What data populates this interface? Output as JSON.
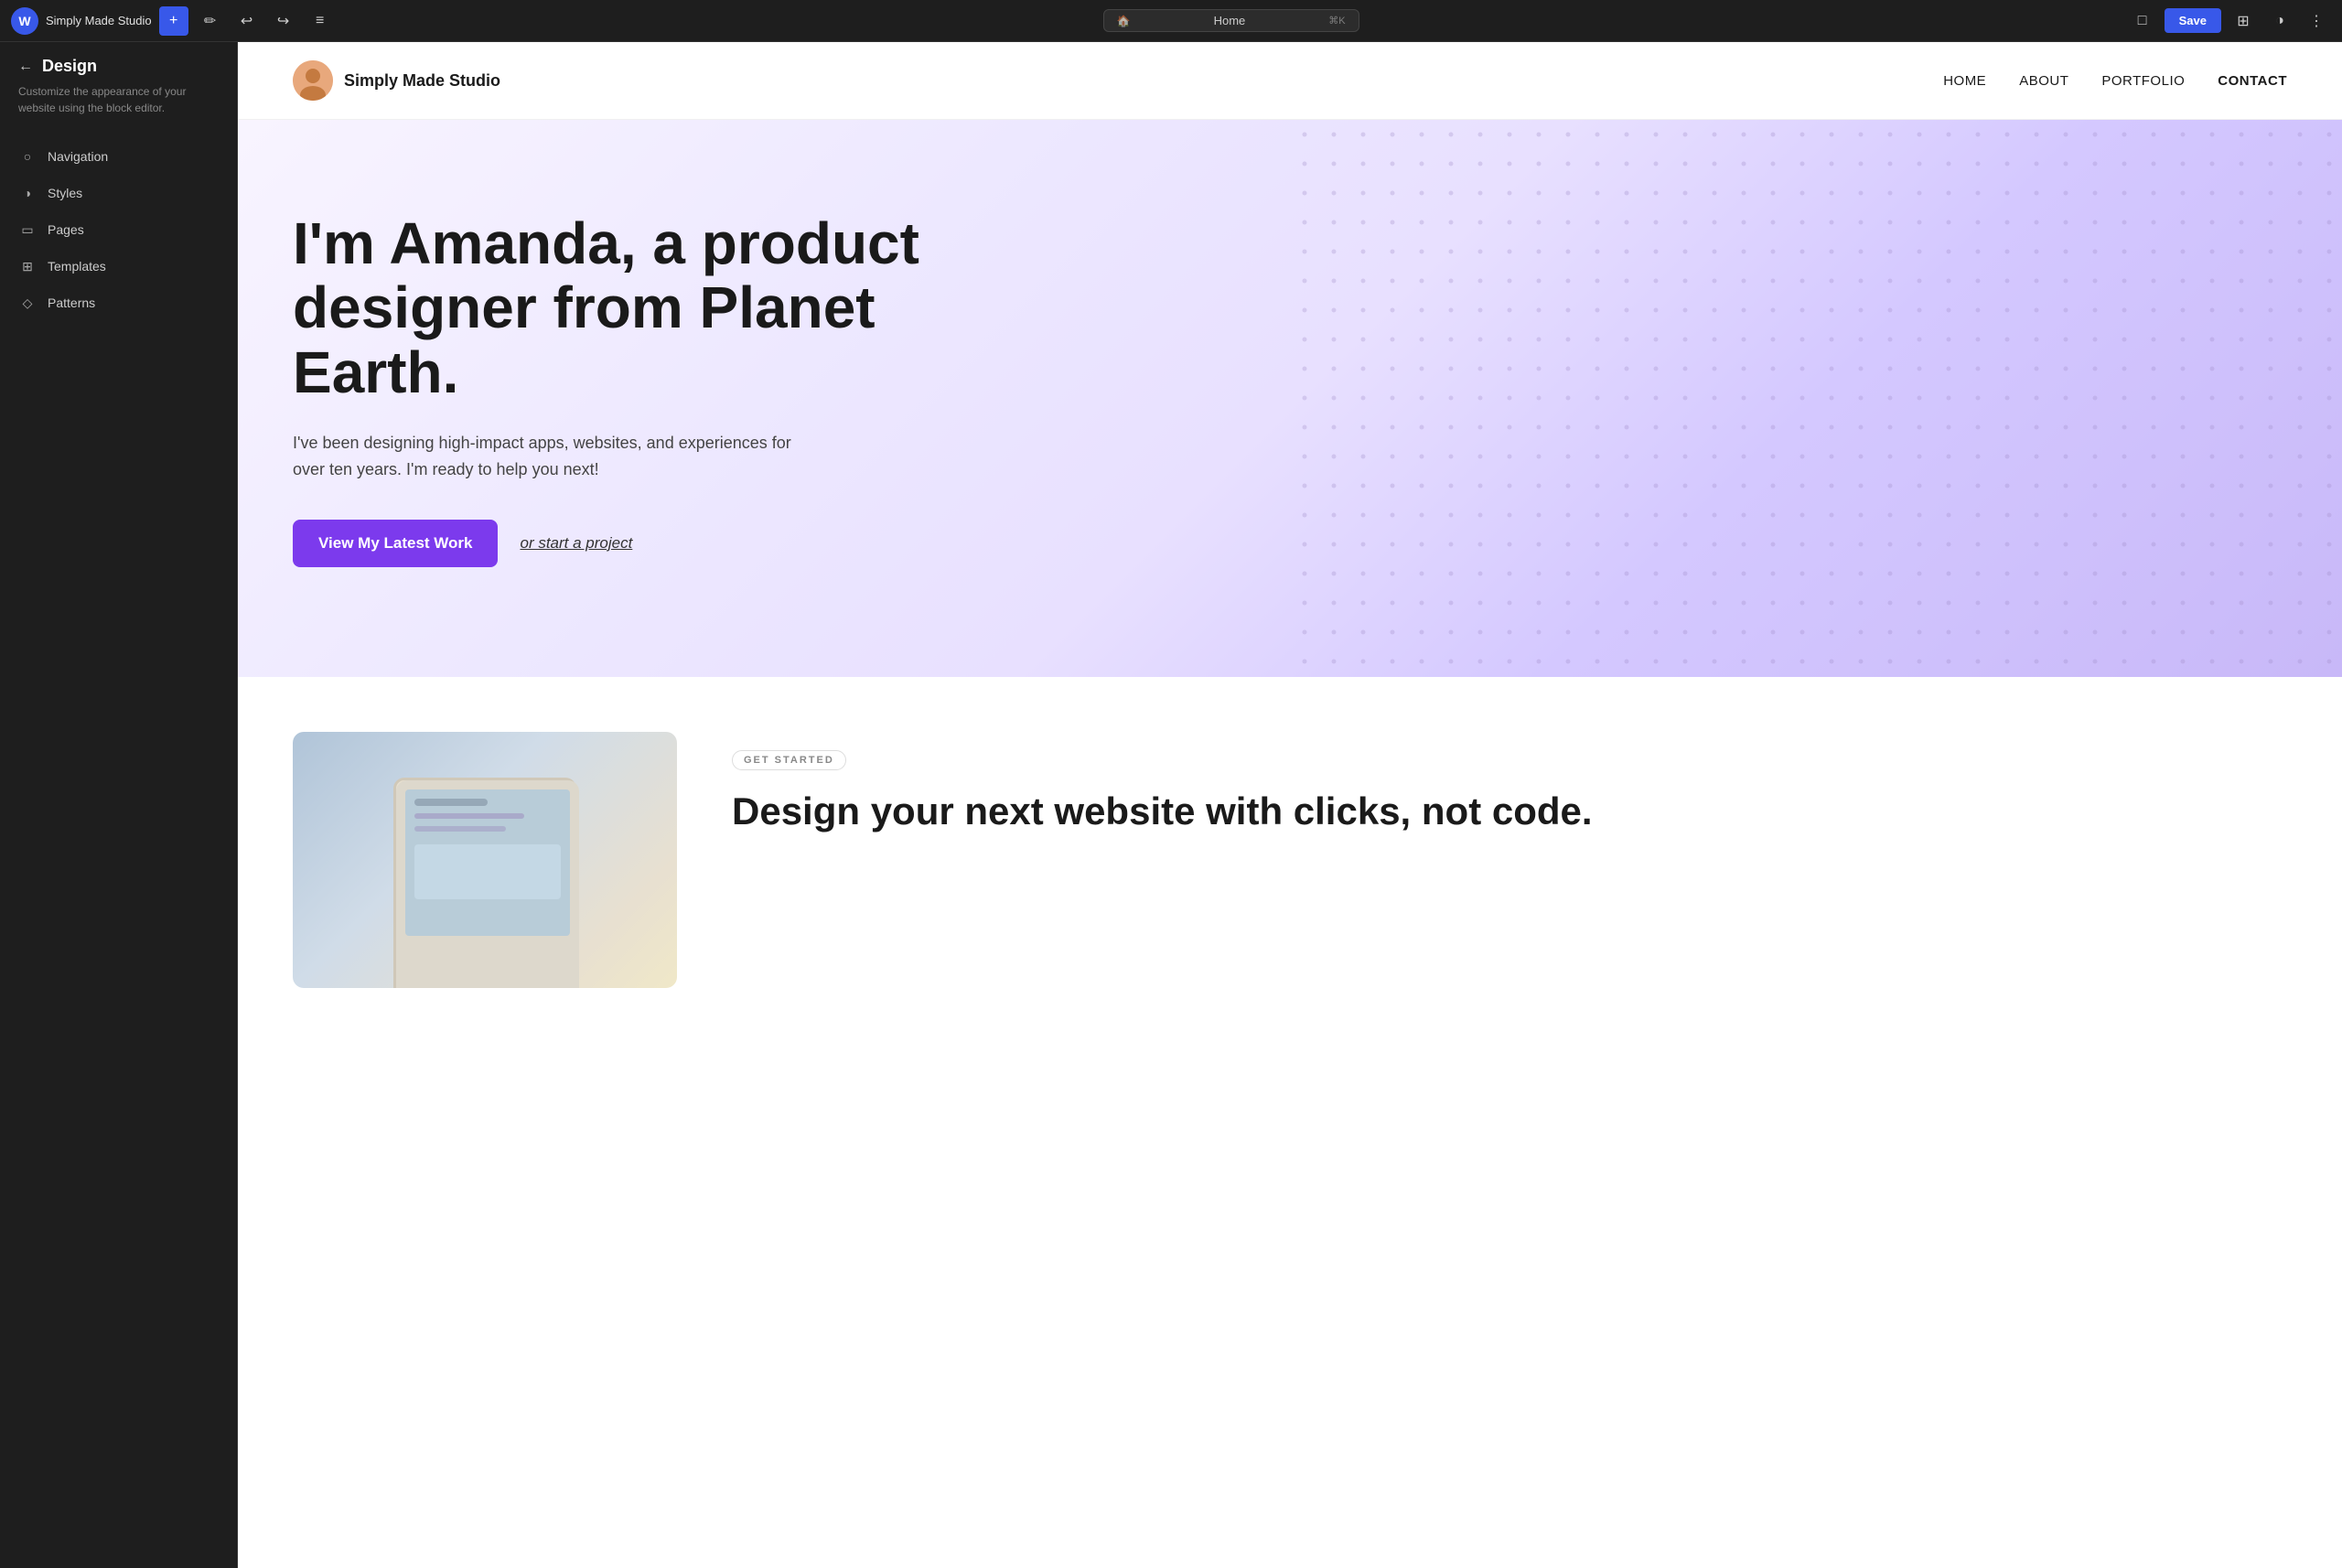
{
  "topbar": {
    "wp_logo": "W",
    "site_title": "Simply Made Studio",
    "toolbar": {
      "add_label": "+",
      "draw_label": "✏",
      "undo_label": "↩",
      "redo_label": "↪",
      "list_label": "≡"
    },
    "urlbar": {
      "icon": "🏠",
      "text": "Home",
      "shortcut": "⌘K"
    },
    "right": {
      "view_label": "□",
      "save_label": "Save",
      "toggle_label": "⊞",
      "contrast_label": "◑",
      "more_label": "⋮"
    }
  },
  "sidebar": {
    "back_label": "←",
    "title": "Design",
    "description": "Customize the appearance of your website using the block editor.",
    "items": [
      {
        "id": "navigation",
        "label": "Navigation",
        "icon": "○"
      },
      {
        "id": "styles",
        "label": "Styles",
        "icon": "◑"
      },
      {
        "id": "pages",
        "label": "Pages",
        "icon": "▭"
      },
      {
        "id": "templates",
        "label": "Templates",
        "icon": "⊞"
      },
      {
        "id": "patterns",
        "label": "Patterns",
        "icon": "◇"
      }
    ]
  },
  "site": {
    "logo_emoji": "👩",
    "logo_name": "Simply Made Studio",
    "nav": [
      {
        "label": "HOME"
      },
      {
        "label": "ABOUT"
      },
      {
        "label": "PORTFOLIO"
      },
      {
        "label": "CONTACT"
      }
    ],
    "hero": {
      "title": "I'm Amanda, a product designer from Planet Earth.",
      "subtitle": "I've been designing high-impact apps, websites, and experiences for over ten years. I'm ready to help you next!",
      "btn_primary": "View My Latest Work",
      "btn_link": "or start a project"
    },
    "below_hero": {
      "get_started": "GET STARTED",
      "section_title": "Design your next website with clicks, not code."
    }
  }
}
